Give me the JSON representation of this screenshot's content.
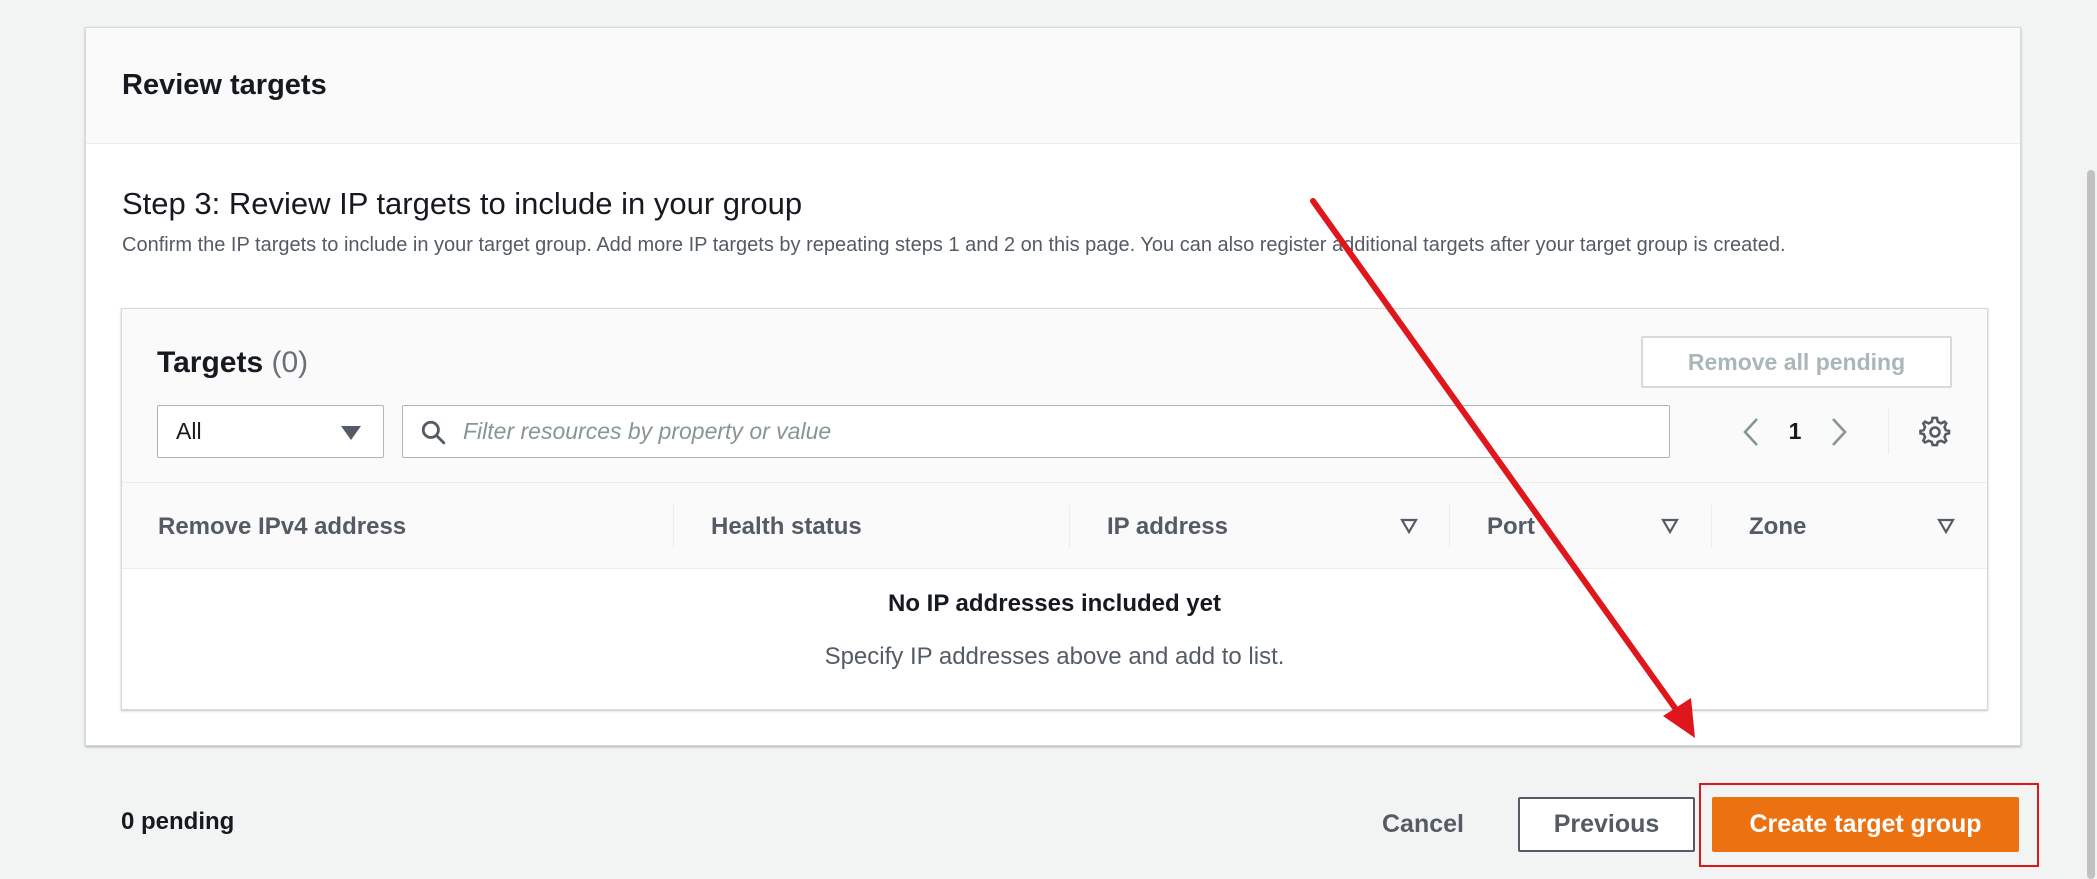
{
  "panel": {
    "title": "Review targets",
    "step_title": "Step 3: Review IP targets to include in your group",
    "step_description": "Confirm the IP targets to include in your target group. Add more IP targets by repeating steps 1 and 2 on this page. You can also register additional targets after your target group is created."
  },
  "targets": {
    "title": "Targets",
    "count": "(0)",
    "remove_all_label": "Remove all pending",
    "filter_select_value": "All",
    "search_placeholder": "Filter resources by property or value",
    "page_number": "1",
    "columns": [
      "Remove IPv4 address",
      "Health status",
      "IP address",
      "Port",
      "Zone"
    ],
    "empty_title": "No IP addresses included yet",
    "empty_description": "Specify IP addresses above and add to list."
  },
  "footer": {
    "pending": "0 pending",
    "cancel_label": "Cancel",
    "previous_label": "Previous",
    "create_label": "Create target group"
  },
  "icons": {
    "search": "search-icon",
    "caret": "caret-down-icon",
    "prev": "chevron-left-icon",
    "next": "chevron-right-icon",
    "settings": "gear-icon",
    "sort": "sort-down-icon"
  },
  "colors": {
    "primary_button": "#ec7211",
    "annotation": "#e0161d",
    "background": "#f2f3f3"
  }
}
